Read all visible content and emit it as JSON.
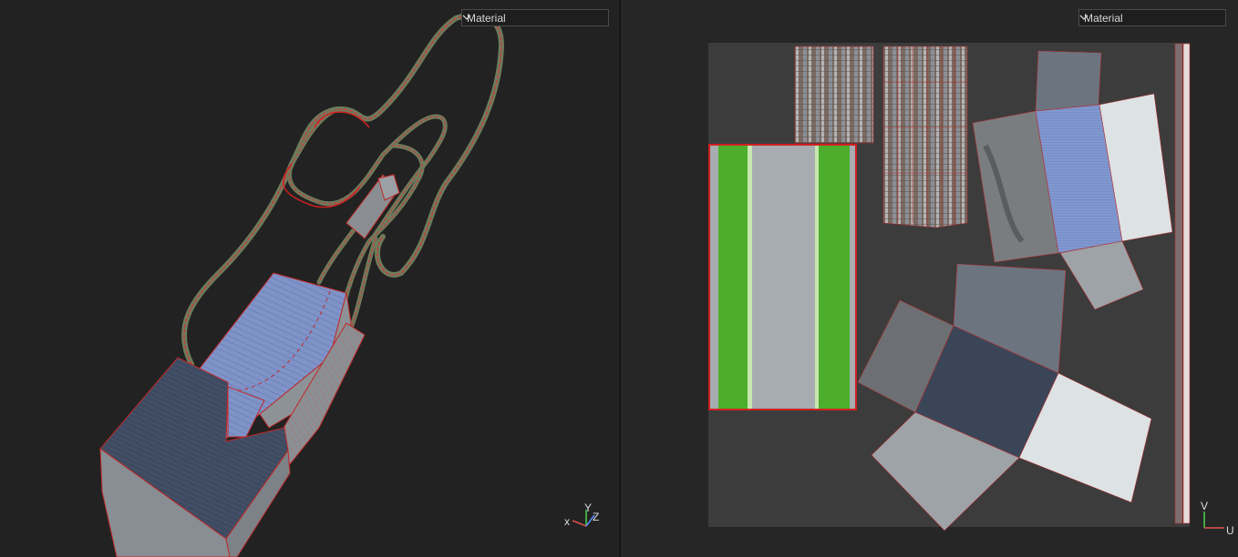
{
  "viewport_3d": {
    "material_select": {
      "value": "Material"
    },
    "gizmo": {
      "x_label": "x",
      "y_label": "Y",
      "z_label": "Z"
    }
  },
  "viewport_uv": {
    "material_select": {
      "value": "Material"
    },
    "gizmo": {
      "v_label": "V",
      "u_label": "U"
    }
  },
  "colors": {
    "background": "#222222",
    "uv_canvas": "#3c3c3c",
    "seam_red": "#d02020",
    "grass_green": "#4cae2c",
    "road_grey": "#a6acb0",
    "roof_blue": "#7a8fc4"
  },
  "icons": [
    "chevron-down-icon",
    "axis-gizmo-icon",
    "uv-axis-gizmo-icon"
  ]
}
